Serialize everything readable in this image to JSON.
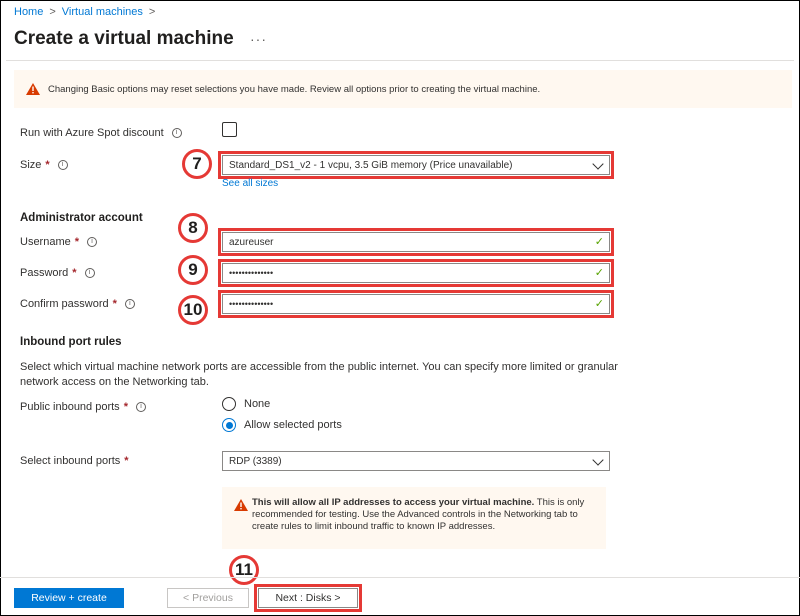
{
  "breadcrumb": {
    "home": "Home",
    "sep1": ">",
    "vms": "Virtual machines",
    "sep2": ">"
  },
  "page": {
    "title": "Create a virtual machine",
    "more": "···"
  },
  "banner": {
    "text": "Changing Basic options may reset selections you have made. Review all options prior to creating the virtual machine."
  },
  "spot": {
    "label": "Run with Azure Spot discount",
    "info": "i",
    "checked": false
  },
  "size": {
    "label": "Size",
    "required": "*",
    "info": "i",
    "value": "Standard_DS1_v2 - 1 vcpu, 3.5 GiB memory (Price unavailable)",
    "link": "See all sizes",
    "callout": "7"
  },
  "admin": {
    "heading": "Administrator account",
    "username": {
      "label": "Username",
      "required": "*",
      "info": "i",
      "value": "azureuser",
      "check": "✓",
      "callout": "8"
    },
    "password": {
      "label": "Password",
      "required": "*",
      "info": "i",
      "value": "••••••••••••••",
      "check": "✓",
      "callout": "9"
    },
    "confirm": {
      "label": "Confirm password",
      "required": "*",
      "info": "i",
      "value": "••••••••••••••",
      "check": "✓",
      "callout": "10"
    }
  },
  "inbound": {
    "heading": "Inbound port rules",
    "description": "Select which virtual machine network ports are accessible from the public internet. You can specify more limited or granular network access on the Networking tab.",
    "public_label": "Public inbound ports",
    "public_required": "*",
    "public_info": "i",
    "options": [
      "None",
      "Allow selected ports"
    ],
    "selected": "Allow selected ports",
    "select_label": "Select inbound ports",
    "select_required": "*",
    "select_value": "RDP (3389)"
  },
  "note": {
    "bold": "This will allow all IP addresses to access your virtual machine.",
    "rest": " This is only recommended for testing.  Use the Advanced controls in the Networking tab to create rules to limit inbound traffic to known IP addresses."
  },
  "footer": {
    "review": "Review + create",
    "previous": "< Previous",
    "next": "Next : Disks >",
    "callout": "11"
  },
  "colors": {
    "accent": "#0078d4",
    "highlight": "#e53935",
    "warning": "#d83b01",
    "valid": "#57a300"
  }
}
